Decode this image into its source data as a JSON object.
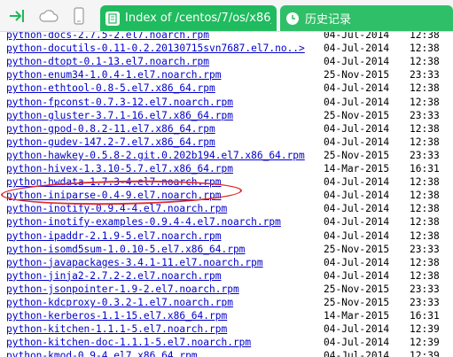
{
  "toolbar": {
    "icons": [
      "sidebar-toggle-icon",
      "cloud-icon",
      "phone-icon"
    ]
  },
  "tabs": [
    {
      "title": "Index of /centos/7/os/x86_",
      "active": true,
      "icon": "page-icon"
    },
    {
      "title": "历史记录",
      "active": false,
      "icon": "clock-icon"
    }
  ],
  "files": [
    {
      "name": "python-docs-2.7.5-2.el7.noarch.rpm",
      "date": "04-Jul-2014",
      "time": "12:38"
    },
    {
      "name": "python-docutils-0.11-0.2.20130715svn7687.el7.no..>",
      "date": "04-Jul-2014",
      "time": "12:38"
    },
    {
      "name": "python-dtopt-0.1-13.el7.noarch.rpm",
      "date": "04-Jul-2014",
      "time": "12:38"
    },
    {
      "name": "python-enum34-1.0.4-1.el7.noarch.rpm",
      "date": "25-Nov-2015",
      "time": "23:33"
    },
    {
      "name": "python-ethtool-0.8-5.el7.x86_64.rpm",
      "date": "04-Jul-2014",
      "time": "12:38"
    },
    {
      "name": "python-fpconst-0.7.3-12.el7.noarch.rpm",
      "date": "04-Jul-2014",
      "time": "12:38"
    },
    {
      "name": "python-gluster-3.7.1-16.el7.x86_64.rpm",
      "date": "25-Nov-2015",
      "time": "23:33"
    },
    {
      "name": "python-gpod-0.8.2-11.el7.x86_64.rpm",
      "date": "04-Jul-2014",
      "time": "12:38"
    },
    {
      "name": "python-gudev-147.2-7.el7.x86_64.rpm",
      "date": "04-Jul-2014",
      "time": "12:38"
    },
    {
      "name": "python-hawkey-0.5.8-2.git.0.202b194.el7.x86_64.rpm",
      "date": "25-Nov-2015",
      "time": "23:33"
    },
    {
      "name": "python-hivex-1.3.10-5.7.el7.x86_64.rpm",
      "date": "14-Mar-2015",
      "time": "16:31"
    },
    {
      "name": "python-hwdata-1.7.3-4.el7.noarch.rpm",
      "date": "04-Jul-2014",
      "time": "12:38"
    },
    {
      "name": "python-iniparse-0.4-9.el7.noarch.rpm",
      "date": "04-Jul-2014",
      "time": "12:38"
    },
    {
      "name": "python-inotify-0.9.4-4.el7.noarch.rpm",
      "date": "04-Jul-2014",
      "time": "12:38"
    },
    {
      "name": "python-inotify-examples-0.9.4-4.el7.noarch.rpm",
      "date": "04-Jul-2014",
      "time": "12:38"
    },
    {
      "name": "python-ipaddr-2.1.9-5.el7.noarch.rpm",
      "date": "04-Jul-2014",
      "time": "12:38"
    },
    {
      "name": "python-isomd5sum-1.0.10-5.el7.x86_64.rpm",
      "date": "25-Nov-2015",
      "time": "23:33"
    },
    {
      "name": "python-javapackages-3.4.1-11.el7.noarch.rpm",
      "date": "04-Jul-2014",
      "time": "12:38"
    },
    {
      "name": "python-jinja2-2.7.2-2.el7.noarch.rpm",
      "date": "04-Jul-2014",
      "time": "12:38"
    },
    {
      "name": "python-jsonpointer-1.9-2.el7.noarch.rpm",
      "date": "25-Nov-2015",
      "time": "23:33"
    },
    {
      "name": "python-kdcproxy-0.3.2-1.el7.noarch.rpm",
      "date": "25-Nov-2015",
      "time": "23:33"
    },
    {
      "name": "python-kerberos-1.1-15.el7.x86_64.rpm",
      "date": "14-Mar-2015",
      "time": "16:31"
    },
    {
      "name": "python-kitchen-1.1.1-5.el7.noarch.rpm",
      "date": "04-Jul-2014",
      "time": "12:39"
    },
    {
      "name": "python-kitchen-doc-1.1.1-5.el7.noarch.rpm",
      "date": "04-Jul-2014",
      "time": "12:39"
    },
    {
      "name": "python-kmod-0.9-4.el7.x86_64.rpm",
      "date": "04-Jul-2014",
      "time": "12:39"
    }
  ],
  "highlighted_file": "python-iniparse-0.4-9.el7.noarch.rpm",
  "colors": {
    "tab_active": "#1fbb5e",
    "link": "#0000cc",
    "highlight": "#e02b2b"
  }
}
